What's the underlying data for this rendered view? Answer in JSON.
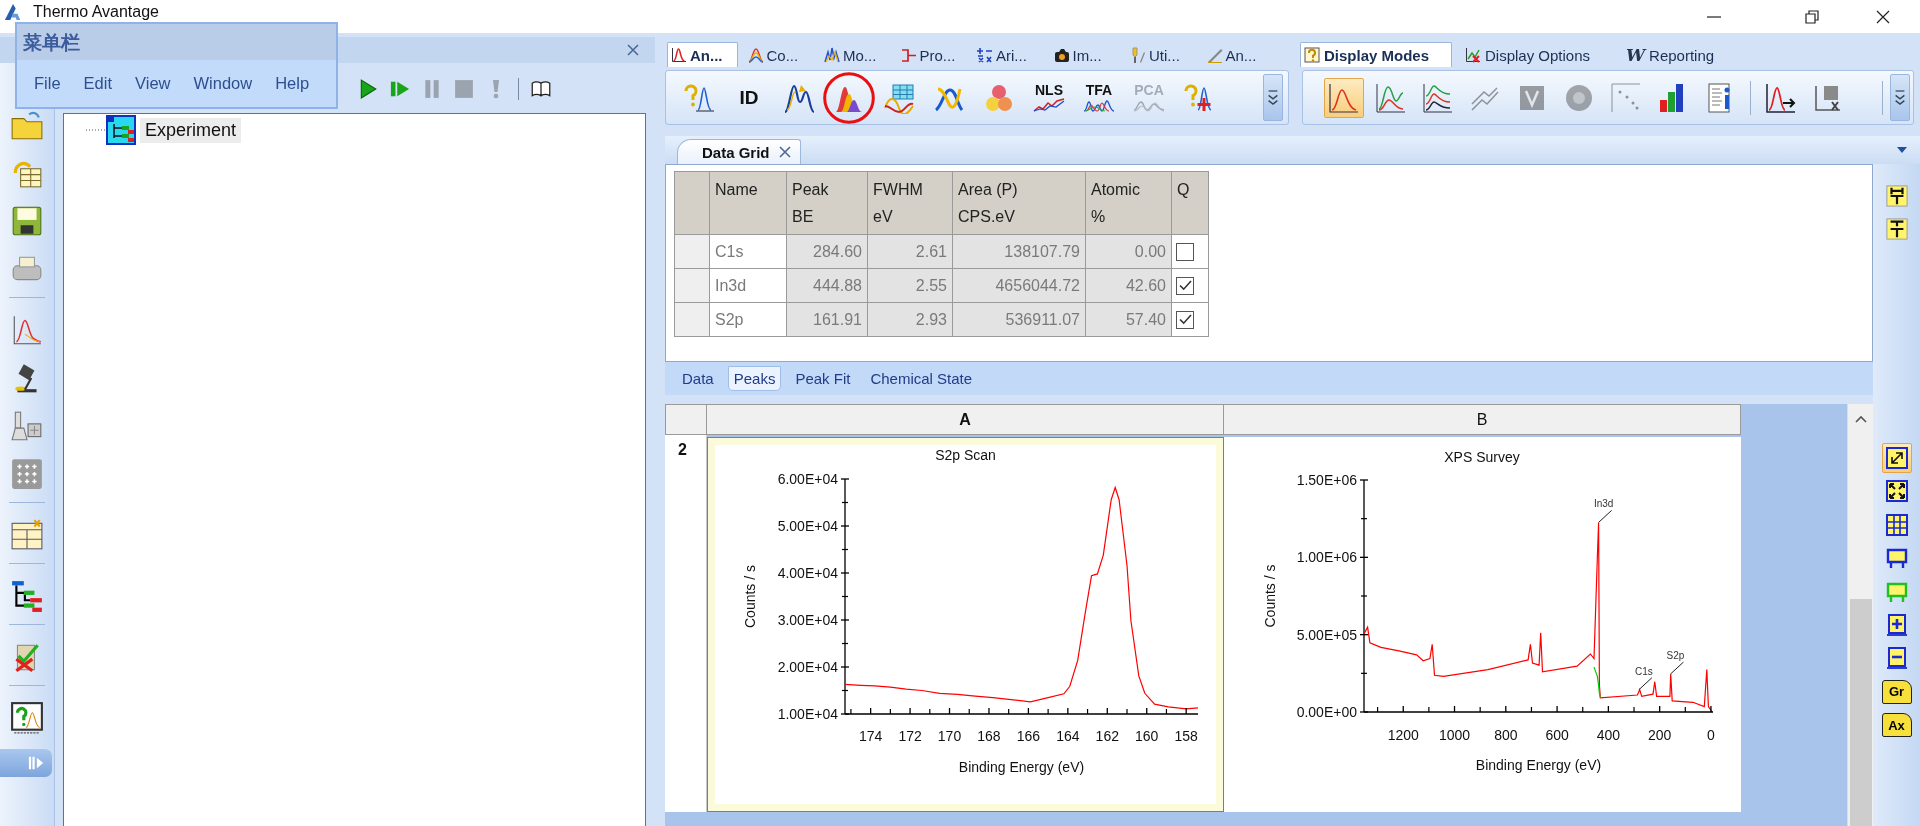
{
  "window": {
    "title": "Thermo Avantage"
  },
  "menu_popup": {
    "title": "菜单栏",
    "items": [
      "File",
      "Edit",
      "View",
      "Window",
      "Help"
    ]
  },
  "experiment_panel": {
    "run_controls": [
      {
        "disabled": false
      },
      {
        "disabled": false
      },
      {
        "disabled": true
      },
      {
        "disabled": true
      },
      {
        "disabled": true
      },
      {
        "disabled": false
      }
    ],
    "tree": [
      {
        "label": "Experiment",
        "selected": true
      }
    ]
  },
  "ribbon": {
    "analysis_tabs": [
      {
        "label": "An...",
        "selected": true
      },
      {
        "label": "Co...",
        "selected": false
      },
      {
        "label": "Mo...",
        "selected": false
      },
      {
        "label": "Pro...",
        "selected": false
      },
      {
        "label": "Ari...",
        "selected": false
      },
      {
        "label": "Im...",
        "selected": false
      },
      {
        "label": "Uti...",
        "selected": false
      },
      {
        "label": "An...",
        "selected": false
      }
    ],
    "display_tabs": [
      {
        "label": "Display Modes",
        "selected": true
      },
      {
        "label": "Display Options",
        "selected": false
      },
      {
        "label": "Reporting",
        "selected": false,
        "glyph": "W"
      }
    ],
    "analysis_tools": [
      {
        "disabled": false,
        "circled": false
      },
      {
        "label": "ID",
        "disabled": false,
        "circled": false
      },
      {
        "disabled": false,
        "circled": false
      },
      {
        "disabled": false,
        "circled": true
      },
      {
        "disabled": false,
        "circled": false
      },
      {
        "disabled": false,
        "circled": false
      },
      {
        "disabled": false,
        "circled": false
      },
      {
        "label": "NLS",
        "disabled": false,
        "circled": false
      },
      {
        "label": "TFA",
        "disabled": false,
        "circled": false
      },
      {
        "label": "PCA",
        "disabled": true,
        "circled": false
      },
      {
        "disabled": false,
        "circled": false
      }
    ],
    "display_tools": [
      {
        "selected": true,
        "disabled": false
      },
      {
        "selected": false,
        "disabled": false
      },
      {
        "selected": false,
        "disabled": false
      },
      {
        "selected": false,
        "disabled": true
      },
      {
        "selected": false,
        "disabled": true
      },
      {
        "selected": false,
        "disabled": true
      },
      {
        "selected": false,
        "disabled": true
      },
      {
        "selected": false,
        "disabled": false
      },
      {
        "selected": false,
        "disabled": false
      },
      {
        "selected": false,
        "disabled": false
      },
      {
        "selected": false,
        "disabled": false
      }
    ]
  },
  "document_tab": {
    "label": "Data Grid"
  },
  "data_grid": {
    "columns": [
      "Name",
      "Peak\nBE",
      "FWHM\neV",
      "Area (P)\nCPS.eV",
      "Atomic\n%",
      "Q"
    ],
    "rows": [
      {
        "cells": [
          "C1s",
          "284.60",
          "2.61",
          "138107.79",
          "0.00"
        ],
        "checked": false
      },
      {
        "cells": [
          "In3d",
          "444.88",
          "2.55",
          "4656044.72",
          "42.60"
        ],
        "checked": true
      },
      {
        "cells": [
          "S2p",
          "161.91",
          "2.93",
          "536911.07",
          "57.40"
        ],
        "checked": true
      }
    ],
    "tabs": [
      {
        "label": "Data",
        "selected": false
      },
      {
        "label": "Peaks",
        "selected": true
      },
      {
        "label": "Peak Fit",
        "selected": false
      },
      {
        "label": "Chemical State",
        "selected": false
      }
    ]
  },
  "sheet": {
    "columns": [
      {
        "label": "A",
        "selected": true
      },
      {
        "label": "B",
        "selected": false
      }
    ],
    "row_label": "2",
    "cells": [
      {
        "chart_data": {
          "type": "line",
          "title": "S2p Scan",
          "xlabel": "Binding Energy (eV)",
          "ylabel": "Counts / s",
          "x": [
            175.3,
            174.5,
            173.8,
            173,
            172.2,
            171.4,
            170.5,
            169.6,
            168.7,
            167.8,
            167,
            165.9,
            165,
            164.2,
            163.9,
            163.5,
            163.1,
            162.8,
            162.5,
            162.2,
            161.8,
            161.6,
            161.4,
            161,
            160.8,
            160.4,
            160.1,
            159.6,
            158.9,
            158,
            157.4
          ],
          "values": [
            16300,
            16100,
            16000,
            15700,
            15300,
            15000,
            14400,
            14200,
            13800,
            13500,
            13100,
            12600,
            13500,
            14300,
            15900,
            21400,
            32000,
            39400,
            39800,
            43800,
            55600,
            58200,
            55600,
            41600,
            29900,
            18100,
            14400,
            12100,
            11500,
            11100,
            11300
          ],
          "xlim": [
            175.3,
            157.4
          ],
          "ylim": [
            10000,
            60000
          ],
          "xticks": [
            174,
            172,
            170,
            168,
            166,
            164,
            162,
            160,
            158
          ],
          "yticks": [
            {
              "value": 10000,
              "label": "1.00E+04"
            },
            {
              "value": 20000,
              "label": "2.00E+04"
            },
            {
              "value": 30000,
              "label": "3.00E+04"
            },
            {
              "value": 40000,
              "label": "4.00E+04"
            },
            {
              "value": 50000,
              "label": "5.00E+04"
            },
            {
              "value": 60000,
              "label": "6.00E+04"
            }
          ]
        }
      },
      {
        "chart_data": {
          "type": "line",
          "title": "XPS Survey",
          "xlabel": "Binding Energy (eV)",
          "ylabel": "Counts / s",
          "x": [
            1353,
            1339,
            1330,
            1287,
            1217,
            1148,
            1122,
            1096,
            1087,
            1078,
            1043,
            870,
            713,
            704,
            696,
            670,
            664,
            657,
            522,
            470,
            456,
            443,
            438,
            435,
            431,
            287,
            278,
            270,
            226,
            219,
            212,
            160,
            157,
            151,
            70,
            26,
            16,
            10,
            -5
          ],
          "series": [
            {
              "color": "#ff0000",
              "values": [
                505000,
                548000,
                447000,
                418000,
                395000,
                369000,
                332000,
                346000,
                438000,
                237000,
                231000,
                274000,
                337000,
                438000,
                317000,
                303000,
                513000,
                260000,
                297000,
                375000,
                346000,
                1009000,
                1226000,
                173000,
                92000,
                110000,
                144000,
                101000,
                115000,
                196000,
                101000,
                101000,
                245000,
                72000,
                63000,
                35000,
                274000,
                35000,
                0
              ]
            },
            {
              "color": "#00cc00",
              "values": [
                null,
                null,
                null,
                null,
                null,
                null,
                null,
                null,
                null,
                null,
                null,
                null,
                null,
                null,
                null,
                null,
                null,
                null,
                null,
                null,
                290000,
                230000,
                170000,
                120000,
                92000,
                null,
                null,
                null,
                null,
                null,
                null,
                null,
                null,
                null,
                null,
                null,
                null,
                null,
                null
              ]
            }
          ],
          "xlim": [
            1353,
            -8
          ],
          "ylim": [
            0,
            1500000
          ],
          "xticks": [
            1200,
            1000,
            800,
            600,
            400,
            200,
            0
          ],
          "yticks": [
            {
              "value": 0,
              "label": "0.00E+00"
            },
            {
              "value": 500000,
              "label": "5.00E+05"
            },
            {
              "value": 1000000,
              "label": "1.00E+06"
            },
            {
              "value": 1500000,
              "label": "1.50E+06"
            }
          ],
          "annotations": [
            "In3d",
            "C1s",
            "S2p"
          ]
        }
      }
    ]
  },
  "chart_tools": [
    {
      "selected": true
    },
    {
      "selected": false
    },
    {
      "selected": false
    },
    {
      "selected": false
    },
    {
      "selected": false
    },
    {
      "selected": false
    },
    {
      "selected": false
    },
    {
      "label": "Gr",
      "selected": false
    },
    {
      "label": "Ax",
      "selected": false
    }
  ]
}
